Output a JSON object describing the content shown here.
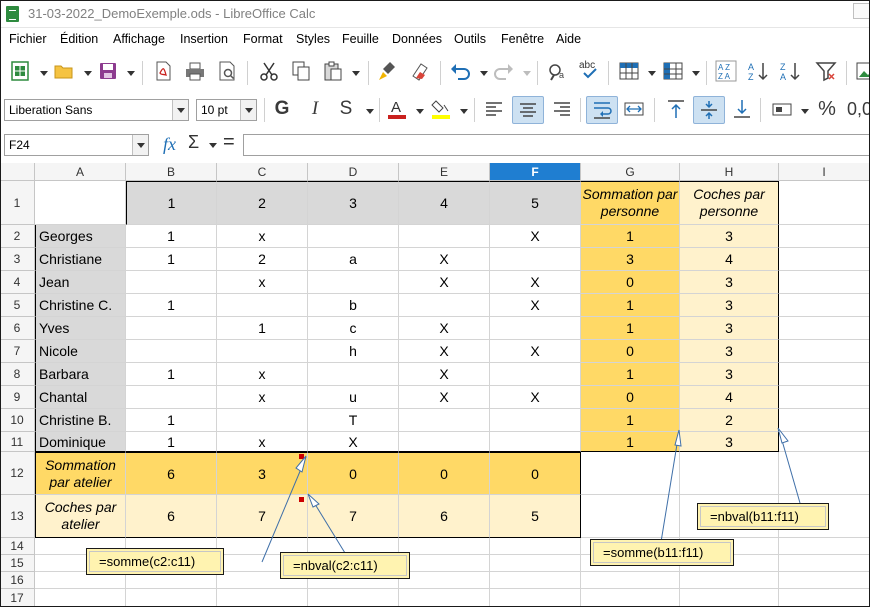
{
  "window": {
    "title": "31-03-2022_DemoExemple.ods - LibreOffice Calc"
  },
  "menu": [
    "Fichier",
    "Édition",
    "Affichage",
    "Insertion",
    "Format",
    "Styles",
    "Feuille",
    "Données",
    "Outils",
    "Fenêtre",
    "Aide"
  ],
  "toolbar": {
    "font_name": "Liberation Sans",
    "font_size": "10 pt",
    "bold_label": "G",
    "italic_label": "I",
    "shadow_label": "S",
    "percent_label": "%",
    "decimal_label": "0,0",
    "accent_colors": {
      "font_color": "#c9211e",
      "highlight_color": "#ffff00"
    }
  },
  "formula_bar": {
    "name_box": "F24",
    "fx_label": "fx",
    "sum_label": "Σ",
    "equals_label": "=",
    "formula": ""
  },
  "sheet": {
    "columns": [
      "A",
      "B",
      "C",
      "D",
      "E",
      "F",
      "G",
      "H",
      "I"
    ],
    "selected_column": "F",
    "rows": [
      "1",
      "2",
      "3",
      "4",
      "5",
      "6",
      "7",
      "8",
      "9",
      "10",
      "11",
      "12",
      "13",
      "14",
      "15",
      "16",
      "17"
    ],
    "header_row": [
      "",
      "1",
      "2",
      "3",
      "4",
      "5",
      "Sommation par personne",
      "Coches par personne"
    ],
    "data": [
      [
        "Georges",
        "1",
        "x",
        "",
        "",
        "X",
        "1",
        "3"
      ],
      [
        "Christiane",
        "1",
        "2",
        "a",
        "X",
        "",
        "3",
        "4"
      ],
      [
        "Jean",
        "",
        "x",
        "",
        "X",
        "X",
        "0",
        "3"
      ],
      [
        "Christine C.",
        "1",
        "",
        "b",
        "",
        "X",
        "1",
        "3"
      ],
      [
        "Yves",
        "",
        "1",
        "c",
        "X",
        "",
        "1",
        "3"
      ],
      [
        "Nicole",
        "",
        "",
        "h",
        "X",
        "X",
        "0",
        "3"
      ],
      [
        "Barbara",
        "1",
        "x",
        "",
        "X",
        "",
        "1",
        "3"
      ],
      [
        "Chantal",
        "",
        "x",
        "u",
        "X",
        "X",
        "0",
        "4"
      ],
      [
        "Christine B.",
        "1",
        "",
        "T",
        "",
        "",
        "1",
        "2"
      ],
      [
        "Dominique",
        "1",
        "x",
        "X",
        "",
        "",
        "1",
        "3"
      ]
    ],
    "sum_row": [
      "Sommation par atelier",
      "6",
      "3",
      "0",
      "0",
      "0"
    ],
    "count_row": [
      "Coches par atelier",
      "6",
      "7",
      "7",
      "6",
      "5"
    ],
    "colors": {
      "header_gray": "#d9d9d9",
      "name_gray": "#d9d9d9",
      "sum_orange": "#ffd966",
      "count_yellow": "#fff2cc",
      "selected_col": "#1f7ed1"
    }
  },
  "callouts": {
    "sum_col": "=somme(c2:c11)",
    "count_col": "=nbval(c2:c11)",
    "sum_row": "=somme(b11:f11)",
    "count_row": "=nbval(b11:f11)"
  }
}
